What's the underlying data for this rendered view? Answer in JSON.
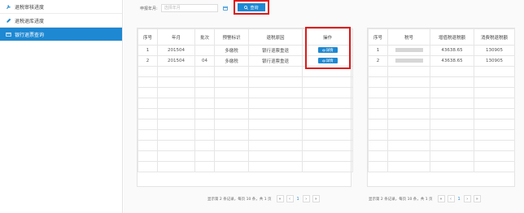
{
  "sidebar": {
    "items": [
      {
        "label": "退税审核进度",
        "icon": "wrench-icon",
        "active": false
      },
      {
        "label": "退税退库进度",
        "icon": "pencil-icon",
        "active": false
      },
      {
        "label": "银行退票查询",
        "icon": "card-icon",
        "active": true
      }
    ]
  },
  "search": {
    "label": "申报年月:",
    "placeholder": "选择年月",
    "button_label": "查询"
  },
  "left_table": {
    "headers": [
      "序号",
      "年月",
      "批次",
      "预警标识",
      "退税原因",
      "操作"
    ],
    "rows": [
      {
        "seq": "1",
        "ym": "201504",
        "batch": "",
        "flag": "多缴税",
        "reason": "银行退票重退",
        "op": "详情"
      },
      {
        "seq": "2",
        "ym": "201504",
        "batch": "04",
        "flag": "多缴税",
        "reason": "银行退票重退",
        "op": "详情"
      }
    ],
    "pager": {
      "info": "显示第 2 条记录，每页 10 条，共 1 页",
      "page": "1"
    }
  },
  "right_table": {
    "headers": [
      "序号",
      "税号",
      "增值税退税额",
      "消费税退税额"
    ],
    "rows": [
      {
        "seq": "1",
        "vat": "43638.65",
        "consumption": "130905"
      },
      {
        "seq": "2",
        "vat": "43638.65",
        "consumption": "130905"
      }
    ],
    "pager": {
      "info": "显示第 2 条记录，每页 10 条，共 1 页",
      "page": "1"
    }
  },
  "colors": {
    "accent": "#1e88d2",
    "highlight": "#e01818"
  }
}
